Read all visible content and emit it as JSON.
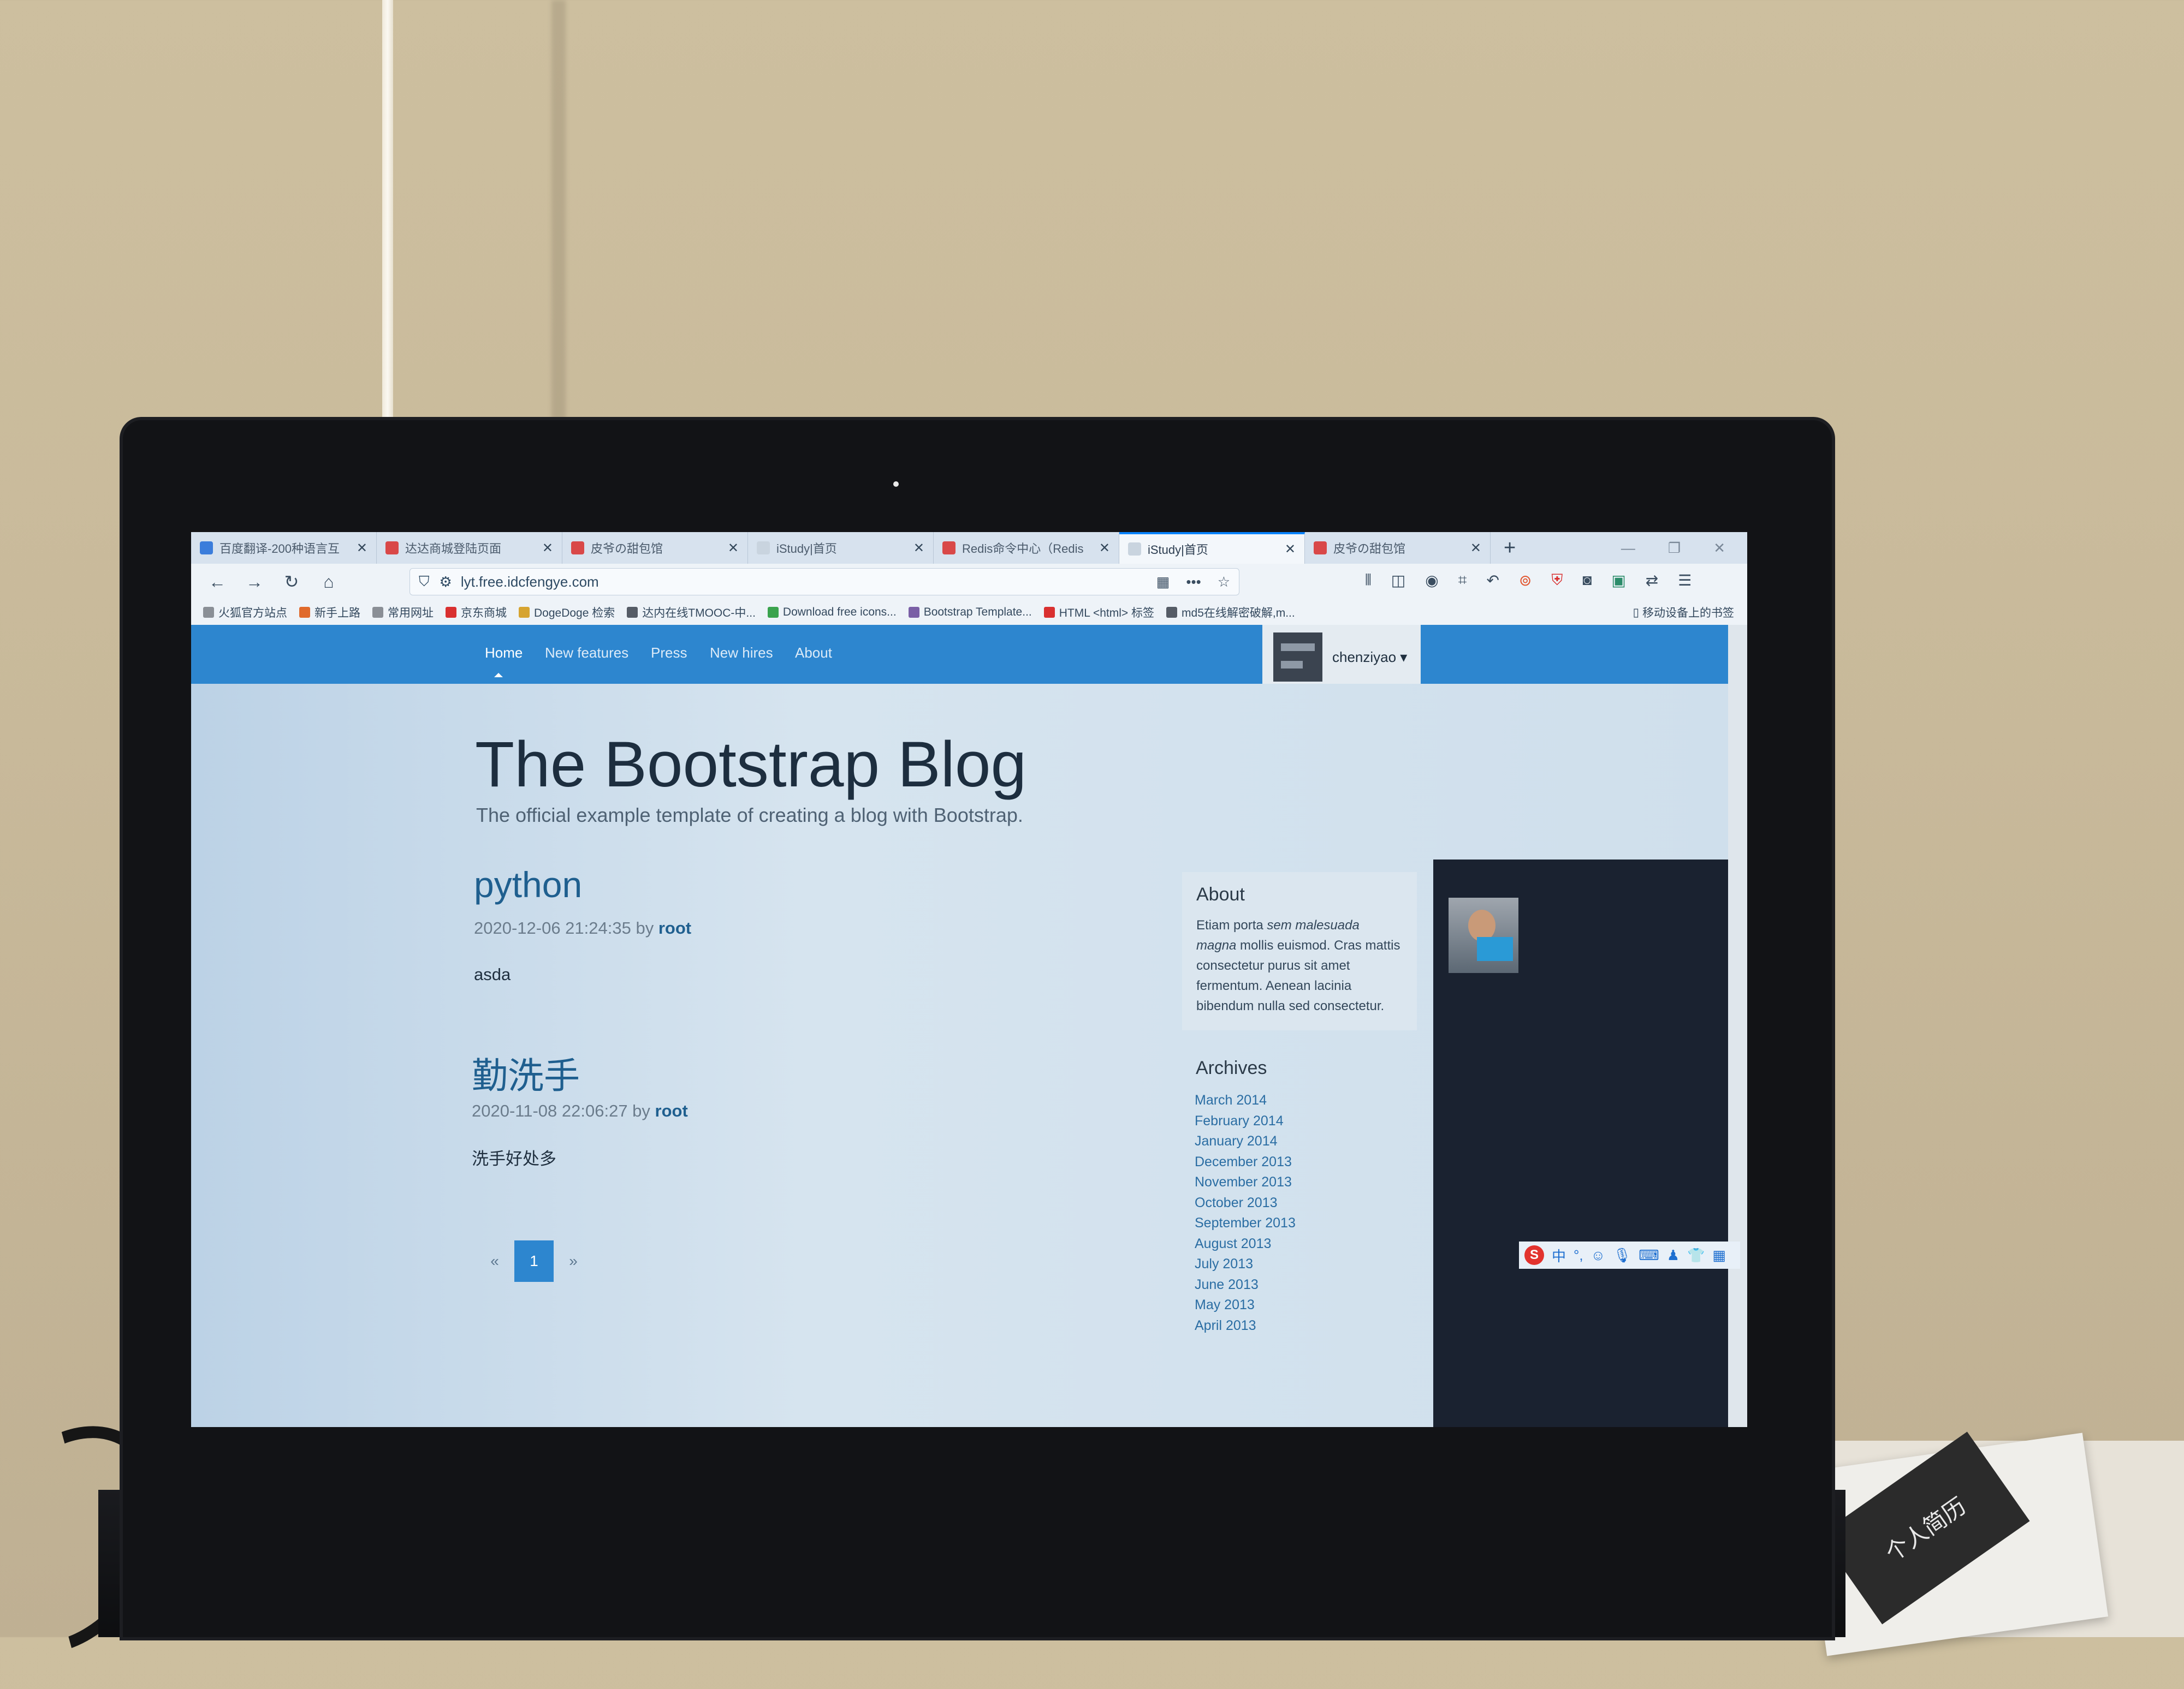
{
  "browser": {
    "tabs": [
      {
        "label": "百度翻译-200种语言互",
        "color": "#3b7ddb",
        "active": false
      },
      {
        "label": "达达商城登陆页面",
        "color": "#d94848",
        "active": false
      },
      {
        "label": "皮爷の甜包馆",
        "color": "#d94848",
        "active": false
      },
      {
        "label": "iStudy|首页",
        "color": "#c9d4df",
        "active": false
      },
      {
        "label": "Redis命令中心（Redis",
        "color": "#d94848",
        "active": false
      },
      {
        "label": "iStudy|首页",
        "color": "#c9d4df",
        "active": true
      },
      {
        "label": "皮爷の甜包馆",
        "color": "#d94848",
        "active": false
      }
    ],
    "url": "lyt.free.idcfengye.com",
    "bookmarks": [
      {
        "label": "火狐官方站点",
        "color": "#8a8f96"
      },
      {
        "label": "新手上路",
        "color": "#e06a2c"
      },
      {
        "label": "常用网址",
        "color": "#8a8f96"
      },
      {
        "label": "京东商城",
        "color": "#d93030"
      },
      {
        "label": "DogeDoge 检索",
        "color": "#d6a431"
      },
      {
        "label": "达内在线TMOOC-中...",
        "color": "#555c66"
      },
      {
        "label": "Download free icons...",
        "color": "#3aa34d"
      },
      {
        "label": "Bootstrap Template...",
        "color": "#7a5fa6"
      },
      {
        "label": "HTML <html> 标签",
        "color": "#d93030"
      },
      {
        "label": "md5在线解密破解,m...",
        "color": "#555c66"
      }
    ],
    "mobile_bookmarks": "移动设备上的书签"
  },
  "site": {
    "nav": [
      "Home",
      "New features",
      "Press",
      "New hires",
      "About"
    ],
    "user": "chenziyao ▾",
    "title": "The Bootstrap Blog",
    "description": "The official example template of creating a blog with Bootstrap.",
    "posts": [
      {
        "title": "python",
        "date": "2020-12-06 21:24:35 by",
        "author": "root",
        "body": "asda"
      },
      {
        "title": "勤洗手",
        "date": "2020-11-08 22:06:27 by",
        "author": "root",
        "body": "洗手好处多"
      }
    ],
    "pagination": {
      "prev": "«",
      "current": "1",
      "next": "»"
    },
    "about": {
      "heading": "About",
      "text_before": "Etiam porta ",
      "text_em": "sem malesuada magna",
      "text_after": " mollis euismod. Cras mattis consectetur purus sit amet fermentum. Aenean lacinia bibendum nulla sed consectetur."
    },
    "archives": {
      "heading": "Archives",
      "items": [
        "March 2014",
        "February 2014",
        "January 2014",
        "December 2013",
        "November 2013",
        "October 2013",
        "September 2013",
        "August 2013",
        "July 2013",
        "June 2013",
        "May 2013",
        "April 2013"
      ]
    }
  },
  "ime": {
    "logo": "S",
    "mode": "中"
  },
  "paper_label": "个人简历"
}
